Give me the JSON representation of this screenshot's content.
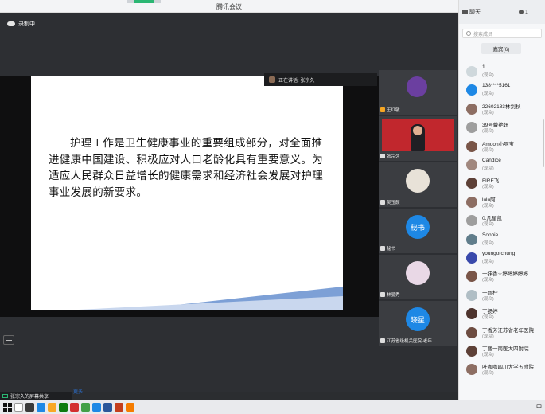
{
  "window": {
    "title": "腾讯会议"
  },
  "recording": {
    "label": "录制中"
  },
  "speaker": {
    "label": "正在讲话: 张宗久"
  },
  "slide": {
    "text": "护理工作是卫生健康事业的重要组成部分，对全面推进健康中国建设、积极应对人口老龄化具有重要意义。为适应人民群众日益增长的健康需求和经济社会发展对护理事业发展的新要求。"
  },
  "thumbnails": [
    {
      "name": "王红敏",
      "kind": "avatar",
      "color": "#6b3fa0"
    },
    {
      "name": "张宗久",
      "kind": "banner",
      "color": "#c1272d"
    },
    {
      "name": "吴玉颜",
      "kind": "badge",
      "badge": "",
      "color": "#e8e2d8"
    },
    {
      "name": "秘书",
      "kind": "badge",
      "badge": "秘书",
      "color": "#1e88e5"
    },
    {
      "name": "林曼秀",
      "kind": "badge",
      "badge": "",
      "color": "#e9d8e6"
    },
    {
      "name": "江苏省级机关医院-老年…",
      "kind": "badge",
      "badge": "晓星",
      "color": "#1e88e5"
    }
  ],
  "panel": {
    "tab_chat": "聊天",
    "tab_members": "1",
    "search_placeholder": "搜索成员",
    "all_button": "嘉宾(6)",
    "more": "更多"
  },
  "members": [
    {
      "name": "1",
      "role": "(观众)",
      "color": "#cfd8dc"
    },
    {
      "name": "138****5161",
      "role": "(观众)",
      "color": "#1e88e5"
    },
    {
      "name": "22602183林剑秋",
      "role": "(观众)",
      "color": "#8d6e63"
    },
    {
      "name": "39号戴艳妍",
      "role": "(观众)",
      "color": "#9e9e9e"
    },
    {
      "name": "Amoon小啊宝",
      "role": "(观众)",
      "color": "#795548"
    },
    {
      "name": "Candice",
      "role": "(观众)",
      "color": "#a1887f"
    },
    {
      "name": "FIRE飞",
      "role": "(观众)",
      "color": "#5d4037"
    },
    {
      "name": "lulu阿",
      "role": "(观众)",
      "color": "#8d6e63"
    },
    {
      "name": "0.凡星凯",
      "role": "(观众)",
      "color": "#9e9e9e"
    },
    {
      "name": "Sophie",
      "role": "(观众)",
      "color": "#607d8b"
    },
    {
      "name": "youngorchung",
      "role": "(观众)",
      "color": "#3949ab"
    },
    {
      "name": "一抹香☆婷婷婷婷婷",
      "role": "(观众)",
      "color": "#795548"
    },
    {
      "name": "一颗柠",
      "role": "(观众)",
      "color": "#b0bec5"
    },
    {
      "name": "丁扬婷",
      "role": "(观众)",
      "color": "#4e342e"
    },
    {
      "name": "丁香芳江苏省老年医院",
      "role": "(观众)",
      "color": "#6d4c41"
    },
    {
      "name": "丁丽一南医大四附院",
      "role": "(观众)",
      "color": "#5d4037"
    },
    {
      "name": "叶咖咖四川大学五附院",
      "role": "(观众)",
      "color": "#8d6e63"
    }
  ],
  "share": {
    "label": "张宗久的屏幕共享"
  },
  "taskbar": {
    "ime": "中"
  }
}
